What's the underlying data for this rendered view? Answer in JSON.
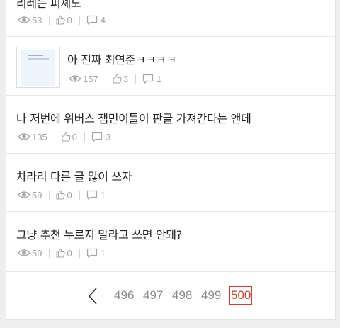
{
  "posts": [
    {
      "title": "리레는 피셰노",
      "views": "53",
      "likes": "0",
      "comments": "4",
      "has_thumbnail": false
    },
    {
      "title": "아 진짜 최연준ㅋㅋㅋㅋ",
      "views": "157",
      "likes": "3",
      "comments": "1",
      "has_thumbnail": true
    },
    {
      "title": "나 저번에 위버스 잼민이들이 판글 가져간다는 앤데",
      "views": "135",
      "likes": "0",
      "comments": "3",
      "has_thumbnail": false
    },
    {
      "title": "차라리 다른 글 많이 쓰자",
      "views": "59",
      "likes": "0",
      "comments": "1",
      "has_thumbnail": false
    },
    {
      "title": "그냥 추천 누르지 말라고 쓰면 안돼?",
      "views": "59",
      "likes": "0",
      "comments": "1",
      "has_thumbnail": false
    }
  ],
  "pagination": {
    "pages": [
      "496",
      "497",
      "498",
      "499",
      "500"
    ],
    "current": "500"
  },
  "icons": {
    "views": "eye-icon",
    "likes": "thumbs-up-icon",
    "comments": "speech-bubble-icon",
    "prev": "chevron-left-icon"
  },
  "colors": {
    "current_page": "#d93a2b",
    "meta_text": "#a6a6a6",
    "title_text": "#222222"
  }
}
